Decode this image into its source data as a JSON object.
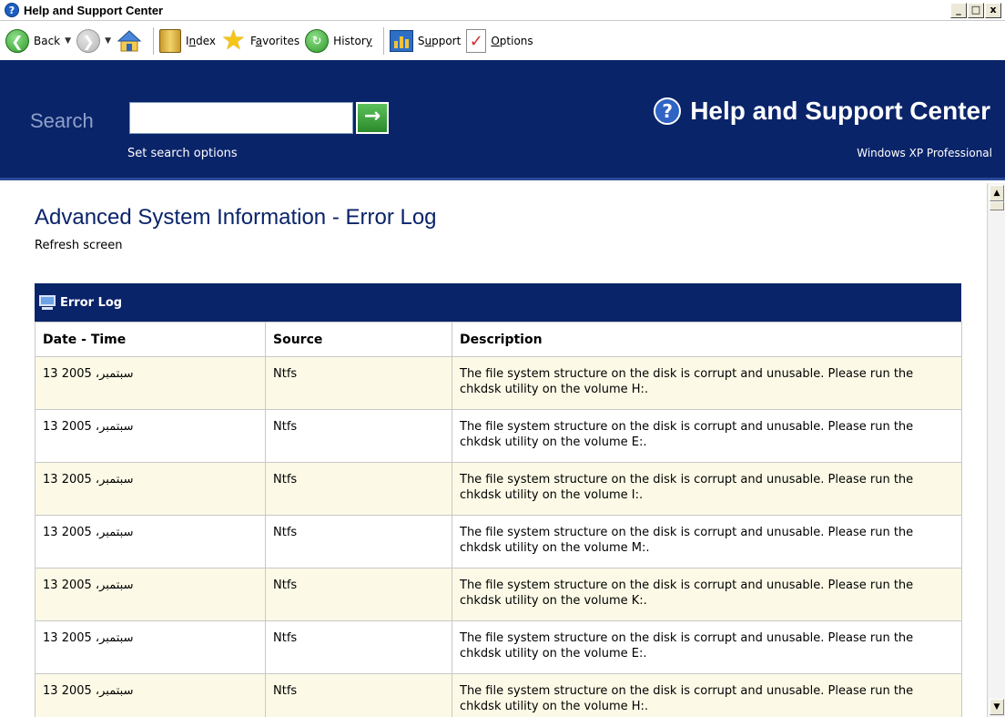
{
  "window": {
    "title": "Help and Support Center",
    "title_icon": "?",
    "buttons": [
      "_",
      "□",
      "x"
    ]
  },
  "toolbar": {
    "back": "Back",
    "index": "Index",
    "favorites_prefix": "F",
    "favorites_u": "a",
    "favorites_rest": "vorites",
    "history_prefix": "Histor",
    "history_u": "y",
    "support_prefix": "S",
    "support_u": "u",
    "support_rest": "pport",
    "options_u": "O",
    "options_rest": "ptions",
    "index_prefix": "I",
    "index_u": "n",
    "index_rest": "dex"
  },
  "header": {
    "search_label": "Search",
    "search_value": "",
    "go_symbol": "→",
    "search_options": "Set search options",
    "brand_title": "Help and Support Center",
    "brand_icon": "?",
    "edition": "Windows XP Professional",
    "bg_color": "#0a246a"
  },
  "page": {
    "title": "Advanced System Information - Error Log",
    "refresh": "Refresh screen"
  },
  "error_log": {
    "panel_title": "Error Log",
    "columns": [
      "Date - Time",
      "Source",
      "Description"
    ],
    "rows": [
      {
        "date": "13 سبتمبر، 2005",
        "source": "Ntfs",
        "description": "The file system structure on the disk is corrupt and unusable. Please run the chkdsk utility on the volume H:."
      },
      {
        "date": "13 سبتمبر، 2005",
        "source": "Ntfs",
        "description": "The file system structure on the disk is corrupt and unusable. Please run the chkdsk utility on the volume E:."
      },
      {
        "date": "13 سبتمبر، 2005",
        "source": "Ntfs",
        "description": "The file system structure on the disk is corrupt and unusable. Please run the chkdsk utility on the volume I:."
      },
      {
        "date": "13 سبتمبر، 2005",
        "source": "Ntfs",
        "description": "The file system structure on the disk is corrupt and unusable. Please run the chkdsk utility on the volume M:."
      },
      {
        "date": "13 سبتمبر، 2005",
        "source": "Ntfs",
        "description": "The file system structure on the disk is corrupt and unusable. Please run the chkdsk utility on the volume K:."
      },
      {
        "date": "13 سبتمبر، 2005",
        "source": "Ntfs",
        "description": "The file system structure on the disk is corrupt and unusable. Please run the chkdsk utility on the volume E:."
      },
      {
        "date": "13 سبتمبر، 2005",
        "source": "Ntfs",
        "description": "The file system structure on the disk is corrupt and unusable. Please run the chkdsk utility on the volume H:."
      }
    ]
  }
}
